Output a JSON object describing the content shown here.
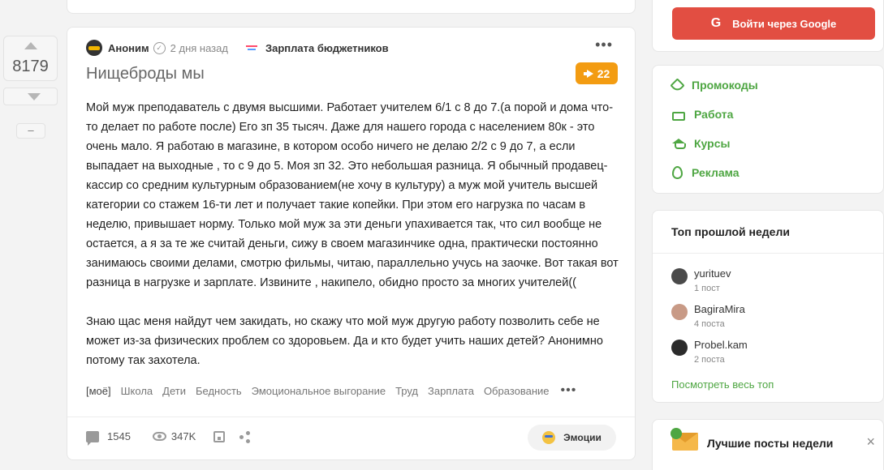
{
  "vote": {
    "count": "8179",
    "minus_label": "–"
  },
  "post": {
    "author": "Аноним",
    "time": "2 дня назад",
    "community": "Зарплата бюджетников",
    "title": "Нищеброды мы",
    "rating": "22",
    "paragraphs": [
      "Мой муж преподаватель с двумя высшими. Работает учителем 6/1 с 8 до 7.(а порой и дома что-то делает по работе после) Его зп 35 тысяч. Даже для нашего города с населением 80к - это очень мало. Я работаю в магазине, в котором особо ничего не делаю 2/2 с 9 до 7, а если выпадает на выходные , то с 9 до 5. Моя зп 32. Это небольшая разница. Я обычный продавец-кассир со средним культурным образованием(не хочу в культуру) а муж мой учитель высшей категории со стажем 16-ти лет и получает такие копейки. При этом его нагрузка по часам в неделю, привышает норму. Только мой муж за эти деньги упахивается так, что сил вообще не остается, а я за те же считай деньги, сижу в своем магазинчике одна, практически постоянно занимаюсь своими делами, смотрю фильмы, читаю, параллельно учусь на заочке. Вот такая вот разница в нагрузке и зарплате. Извините , накипело, обидно просто за многих учителей((",
      "Знаю щас меня найдут чем закидать, но скажу что мой муж другую работу позволить себе не может из-за физических проблем со здоровьем. Да и кто будет учить наших детей? Анонимно потому так захотела."
    ],
    "tags": [
      "[моё]",
      "Школа",
      "Дети",
      "Бедность",
      "Эмоциональное выгорание",
      "Труд",
      "Зарплата",
      "Образование"
    ],
    "comments": "1545",
    "views": "347K",
    "emotions_label": "Эмоции"
  },
  "sidebar": {
    "google_label": "Войти через Google",
    "links": [
      {
        "label": "Промокоды",
        "icon": "tag-icon"
      },
      {
        "label": "Работа",
        "icon": "briefcase-icon"
      },
      {
        "label": "Курсы",
        "icon": "graduation-cap-icon"
      },
      {
        "label": "Реклама",
        "icon": "fire-icon"
      }
    ],
    "top_title": "Топ прошлой недели",
    "top_users": [
      {
        "name": "yurituev",
        "posts": "1 пост",
        "color": "#4a4a4a"
      },
      {
        "name": "BagiraMira",
        "posts": "4 поста",
        "color": "#c89a86"
      },
      {
        "name": "Probel.kam",
        "posts": "2 поста",
        "color": "#2b2b2b"
      }
    ],
    "top_link": "Посмотреть весь топ",
    "best_title": "Лучшие посты недели",
    "best_close": "×"
  }
}
